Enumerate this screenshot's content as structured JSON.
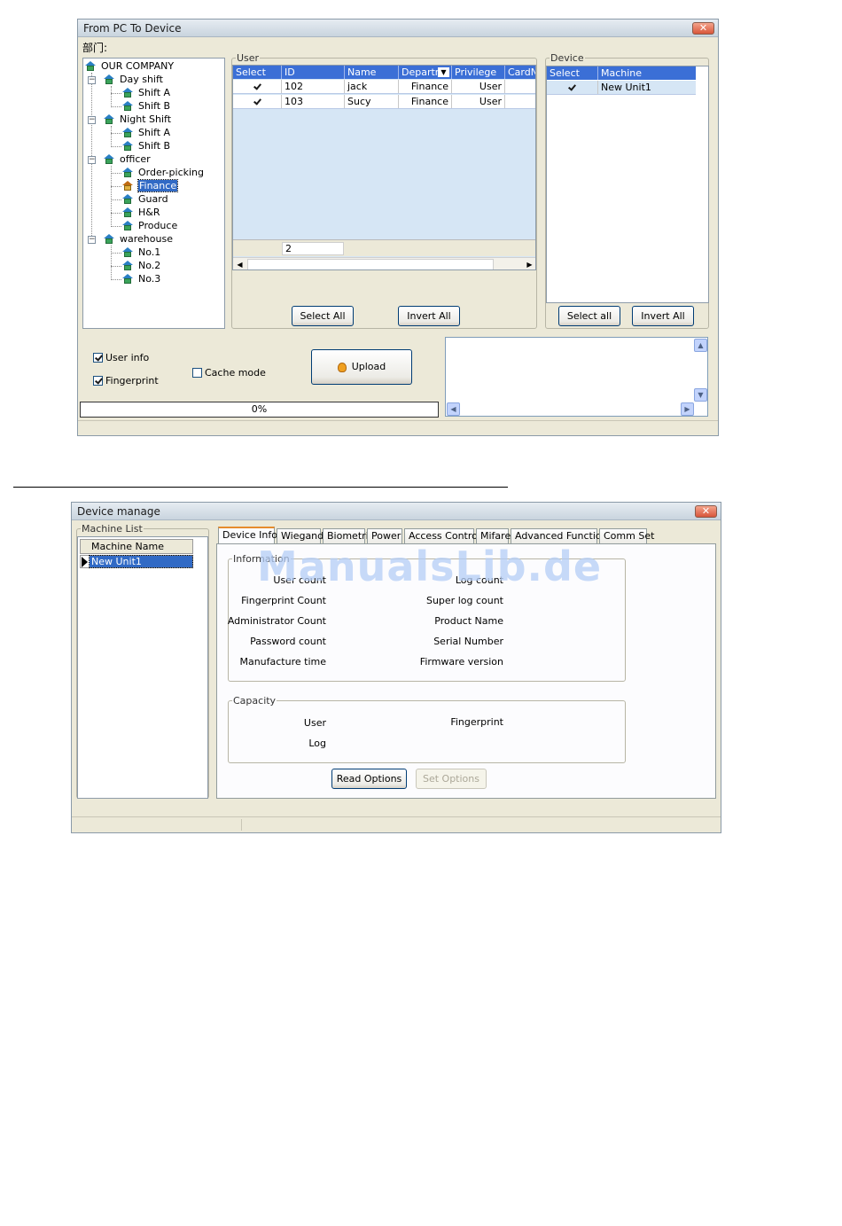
{
  "window1": {
    "title": "From PC To Device",
    "dept_label": "部门:",
    "tree": [
      {
        "label": "OUR COMPANY"
      },
      {
        "label": "Day shift"
      },
      {
        "label": "Shift A"
      },
      {
        "label": "Shift B"
      },
      {
        "label": "Night Shift"
      },
      {
        "label": "Shift A"
      },
      {
        "label": "Shift B"
      },
      {
        "label": "officer"
      },
      {
        "label": "Order-picking"
      },
      {
        "label": "Finance"
      },
      {
        "label": "Guard"
      },
      {
        "label": "H&R"
      },
      {
        "label": "Produce"
      },
      {
        "label": "warehouse"
      },
      {
        "label": "No.1"
      },
      {
        "label": "No.2"
      },
      {
        "label": "No.3"
      }
    ],
    "user_group": {
      "label": "User",
      "columns": [
        "Select",
        "ID",
        "Name",
        "Departm",
        "Privilege",
        "CardN"
      ],
      "rows": [
        {
          "id": "102",
          "name": "jack",
          "dept": "Finance",
          "privilege": "User"
        },
        {
          "id": "103",
          "name": "Sucy",
          "dept": "Finance",
          "privilege": "User"
        }
      ],
      "count": "2",
      "select_all": "Select All",
      "invert_all": "Invert All"
    },
    "device_group": {
      "label": "Device",
      "columns": [
        "Select",
        "Machine"
      ],
      "rows": [
        {
          "machine": "New Unit1"
        }
      ],
      "select_all": "Select all",
      "invert_all": "Invert All"
    },
    "options": {
      "user_info": "User info",
      "fingerprint": "Fingerprint",
      "cache_mode": "Cache mode"
    },
    "upload_label": "Upload",
    "progress_text": "0%",
    "progress_value": 0
  },
  "window2": {
    "title": "Device manage",
    "machine_list_label": "Machine List",
    "machine_list_header": "Machine Name",
    "machine_list_item": "New Unit1",
    "tabs": [
      "Device Info",
      "Wiegand",
      "Biometric",
      "Power",
      "Access Control",
      "Mifare",
      "Advanced Function",
      "Comm Set"
    ],
    "information_label": "Information",
    "info_left": [
      "User count",
      "Fingerprint Count",
      "Administrator Count",
      "Password count",
      "Manufacture time"
    ],
    "info_right": [
      "Log count",
      "Super log count",
      "Product Name",
      "Serial Number",
      "Firmware version"
    ],
    "capacity_label": "Capacity",
    "capacity_user": "User",
    "capacity_log": "Log",
    "capacity_fingerprint": "Fingerprint",
    "read_options": "Read Options",
    "set_options": "Set Options"
  },
  "watermark": "ManualsLib.de"
}
